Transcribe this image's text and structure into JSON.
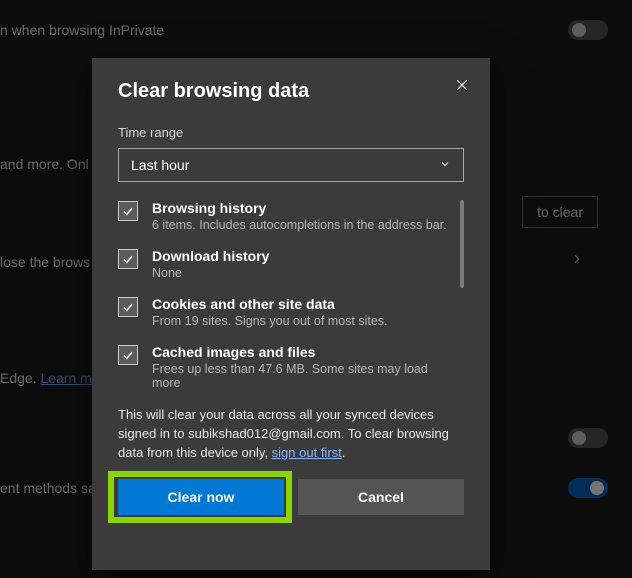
{
  "background": {
    "inprivate_label": "n when browsing InPrivate",
    "and_more": "and more. Onl",
    "close_browser": "lose the brows",
    "edge_learn": "Edge. ",
    "learn_more": "Learn mo",
    "payment_methods": "ent methods sa",
    "choose_to_clear": "to clear"
  },
  "dialog": {
    "title": "Clear browsing data",
    "time_range_label": "Time range",
    "time_range_value": "Last hour",
    "options": [
      {
        "title": "Browsing history",
        "sub": "6 items. Includes autocompletions in the address bar."
      },
      {
        "title": "Download history",
        "sub": "None"
      },
      {
        "title": "Cookies and other site data",
        "sub": "From 19 sites. Signs you out of most sites."
      },
      {
        "title": "Cached images and files",
        "sub": "Frees up less than 47.6 MB. Some sites may load more"
      }
    ],
    "sync_note_prefix": "This will clear your data across all your synced devices signed in to subikshad012@gmail.com. To clear browsing data from this device only, ",
    "sign_out_link": "sign out first",
    "sync_note_suffix": ".",
    "clear_button": "Clear now",
    "cancel_button": "Cancel"
  }
}
